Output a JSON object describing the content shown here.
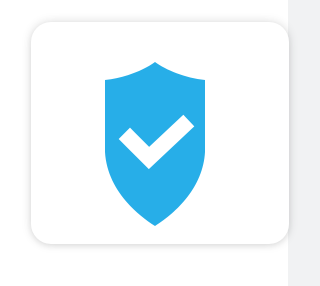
{
  "icon": {
    "name": "shield-check-icon",
    "shield_color": "#27aee8",
    "check_color": "#ffffff"
  },
  "background": {
    "page_color": "#ffffff",
    "card_color": "#ffffff"
  }
}
